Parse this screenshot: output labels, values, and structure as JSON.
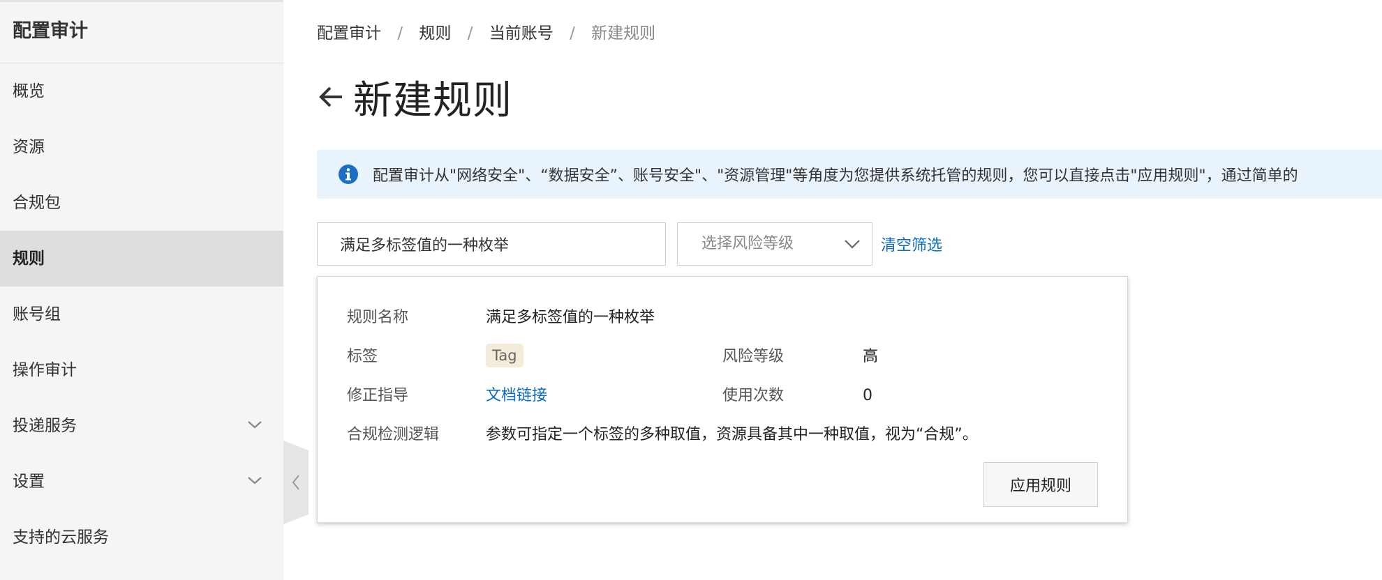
{
  "sidebar": {
    "title": "配置审计",
    "items": [
      {
        "label": "概览"
      },
      {
        "label": "资源"
      },
      {
        "label": "合规包"
      },
      {
        "label": "规则"
      },
      {
        "label": "账号组"
      },
      {
        "label": "操作审计"
      },
      {
        "label": "投递服务"
      },
      {
        "label": "设置"
      },
      {
        "label": "支持的云服务"
      }
    ],
    "active_item": "规则"
  },
  "breadcrumb": {
    "items": [
      "配置审计",
      "规则",
      "当前账号",
      "新建规则"
    ],
    "separator": "/"
  },
  "header": {
    "title": "新建规则"
  },
  "banner": {
    "text": "配置审计从\"网络安全\"、“数据安全”、账号安全\"、\"资源管理\"等角度为您提供系统托管的规则，您可以直接点击\"应用规则\"，通过简单的",
    "icon": "info-icon",
    "color": "#1a6fc4"
  },
  "filters": {
    "search_value": "满足多标签值的一种枚举",
    "risk_placeholder": "选择风险等级",
    "clear_label": "清空筛选"
  },
  "rule_card": {
    "name_label": "规则名称",
    "name_value": "满足多标签值的一种枚举",
    "tag_label": "标签",
    "tag_value": "Tag",
    "risk_label": "风险等级",
    "risk_value": "高",
    "guide_label": "修正指导",
    "guide_value": "文档链接",
    "usage_label": "使用次数",
    "usage_value": "0",
    "logic_label": "合规检测逻辑",
    "logic_value": "参数可指定一个标签的多种取值，资源具备其中一种取值，视为“合规”。",
    "apply_label": "应用规则"
  },
  "colors": {
    "link": "#0a6cc2",
    "banner_bg": "#e8f3fc",
    "sidebar_bg": "#f5f5f5",
    "active_bg": "#dedede"
  }
}
